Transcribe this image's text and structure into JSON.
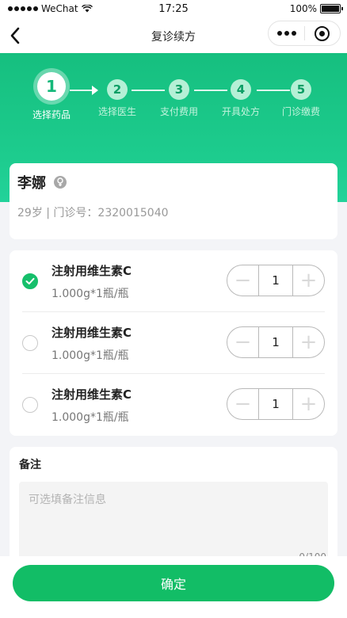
{
  "status_bar": {
    "carrier": "WeChat",
    "time": "17:25",
    "battery": "100%",
    "battery_level": 1.0
  },
  "nav": {
    "title": "复诊续方",
    "back_icon": "chevron-left-icon",
    "more_icon": "more-dots-icon",
    "close_icon": "target-close-icon"
  },
  "steps": [
    {
      "number": "1",
      "label": "选择药品",
      "state": "active"
    },
    {
      "number": "2",
      "label": "选择医生",
      "state": "pending"
    },
    {
      "number": "3",
      "label": "支付费用",
      "state": "pending"
    },
    {
      "number": "4",
      "label": "开具处方",
      "state": "pending"
    },
    {
      "number": "5",
      "label": "门诊缴费",
      "state": "pending"
    }
  ],
  "patient": {
    "name": "李娜",
    "gender_icon": "female-icon",
    "info": "29岁 | 门诊号：2320015040"
  },
  "medicines": [
    {
      "name": "注射用维生素C",
      "spec": "1.000g*1瓶/瓶",
      "quantity": "1",
      "selected": true
    },
    {
      "name": "注射用维生素C",
      "spec": "1.000g*1瓶/瓶",
      "quantity": "1",
      "selected": false
    },
    {
      "name": "注射用维生素C",
      "spec": "1.000g*1瓶/瓶",
      "quantity": "1",
      "selected": false
    }
  ],
  "remark": {
    "title": "备注",
    "placeholder": "可选填备注信息",
    "value": "",
    "counter": "0/100"
  },
  "footer": {
    "confirm_label": "确定"
  },
  "colors": {
    "primary": "#12bd66",
    "header_green": "#1dcc8e"
  }
}
